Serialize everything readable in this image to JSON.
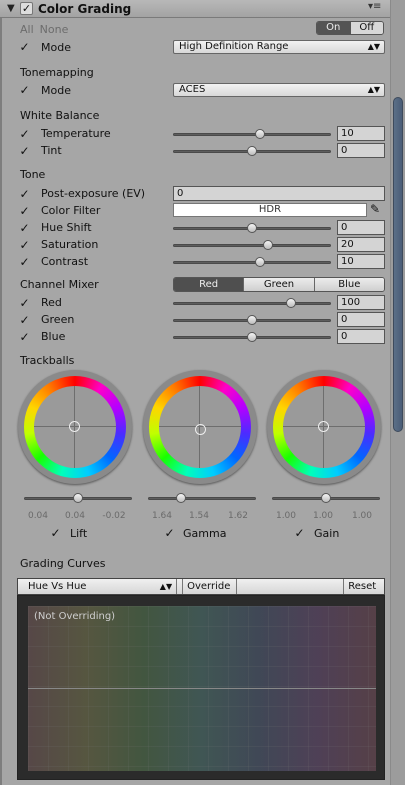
{
  "header": {
    "title": "Color Grading",
    "enabled": true,
    "menu_icon": "menu-icon"
  },
  "all_none": {
    "all": "All",
    "none": "None"
  },
  "toggle": {
    "on": "On",
    "off": "Off",
    "selected": "On"
  },
  "mode": {
    "label": "Mode",
    "value": "High Definition Range"
  },
  "tonemapping": {
    "section": "Tonemapping",
    "mode_label": "Mode",
    "mode_value": "ACES"
  },
  "white_balance": {
    "section": "White Balance",
    "temperature": {
      "label": "Temperature",
      "value": "10",
      "fraction": 0.55
    },
    "tint": {
      "label": "Tint",
      "value": "0",
      "fraction": 0.5
    }
  },
  "tone": {
    "section": "Tone",
    "post_exposure": {
      "label": "Post-exposure (EV)",
      "value": "0"
    },
    "color_filter": {
      "label": "Color Filter",
      "value": "HDR"
    },
    "hue_shift": {
      "label": "Hue Shift",
      "value": "0",
      "fraction": 0.5
    },
    "saturation": {
      "label": "Saturation",
      "value": "20",
      "fraction": 0.6
    },
    "contrast": {
      "label": "Contrast",
      "value": "10",
      "fraction": 0.55
    }
  },
  "channel_mixer": {
    "section": "Channel Mixer",
    "tabs": [
      "Red",
      "Green",
      "Blue"
    ],
    "selected_tab": "Red",
    "red": {
      "label": "Red",
      "value": "100",
      "fraction": 0.75
    },
    "green": {
      "label": "Green",
      "value": "0",
      "fraction": 0.5
    },
    "blue": {
      "label": "Blue",
      "value": "0",
      "fraction": 0.5
    }
  },
  "trackballs": {
    "section": "Trackballs",
    "items": [
      {
        "label": "Lift",
        "values": [
          "0.04",
          "0.04",
          "-0.02"
        ],
        "slider": 0.5
      },
      {
        "label": "Gamma",
        "values": [
          "1.64",
          "1.54",
          "1.62"
        ],
        "slider": 0.3
      },
      {
        "label": "Gain",
        "values": [
          "1.00",
          "1.00",
          "1.00"
        ],
        "slider": 0.5
      }
    ]
  },
  "grading_curves": {
    "section": "Grading Curves",
    "dropdown": "Hue Vs Hue",
    "override": "Override",
    "reset": "Reset",
    "status": "(Not Overriding)"
  }
}
